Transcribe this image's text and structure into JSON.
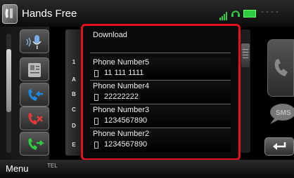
{
  "header": {
    "title": "Hands Free",
    "status_dashes": "----"
  },
  "left_buttons": [
    {
      "icon": "voice-dial-icon"
    },
    {
      "icon": "phonebook-icon"
    },
    {
      "icon": "incoming-calls-icon"
    },
    {
      "icon": "missed-calls-icon"
    },
    {
      "icon": "outgoing-calls-icon"
    }
  ],
  "alphabet_index": [
    "1",
    "A",
    "B",
    "C",
    "D",
    "E"
  ],
  "list": {
    "download_label": "Download",
    "entries": [
      {
        "name": "Phone Number5",
        "number": "11 111 1111"
      },
      {
        "name": "Phone Number4",
        "number": "22222222"
      },
      {
        "name": "Phone Number3",
        "number": "1234567890"
      },
      {
        "name": "Phone Number2",
        "number": "1234567890"
      }
    ]
  },
  "footer": {
    "menu_label": "Menu",
    "tel_label": "TEL"
  },
  "colors": {
    "highlight": "#e2121d",
    "accent_blue": "#1e88e5",
    "accent_green": "#2ecc40",
    "accent_red": "#e53935"
  }
}
